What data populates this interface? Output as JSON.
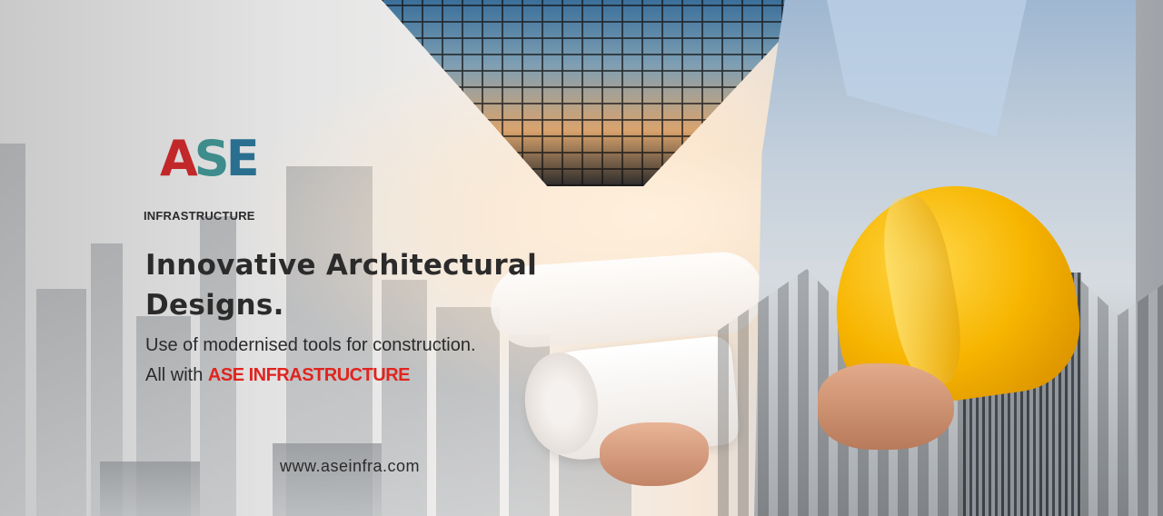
{
  "logo": {
    "letters": {
      "a": "A",
      "s": "S",
      "e": "E"
    },
    "subtitle": "INFRASTRUCTURE"
  },
  "headline": {
    "line1": "Innovative Architectural",
    "line2": "Designs."
  },
  "tagline": {
    "line1": "Use of modernised tools for construction.",
    "line2_prefix": "All with ",
    "brand": "ASE INFRASTRUCTURE"
  },
  "website": "www.aseinfra.com",
  "colors": {
    "brand_red": "#e0241f",
    "logo_red": "#c2282a",
    "logo_teal": "#3e8c8c",
    "helmet_yellow": "#f7b500"
  }
}
